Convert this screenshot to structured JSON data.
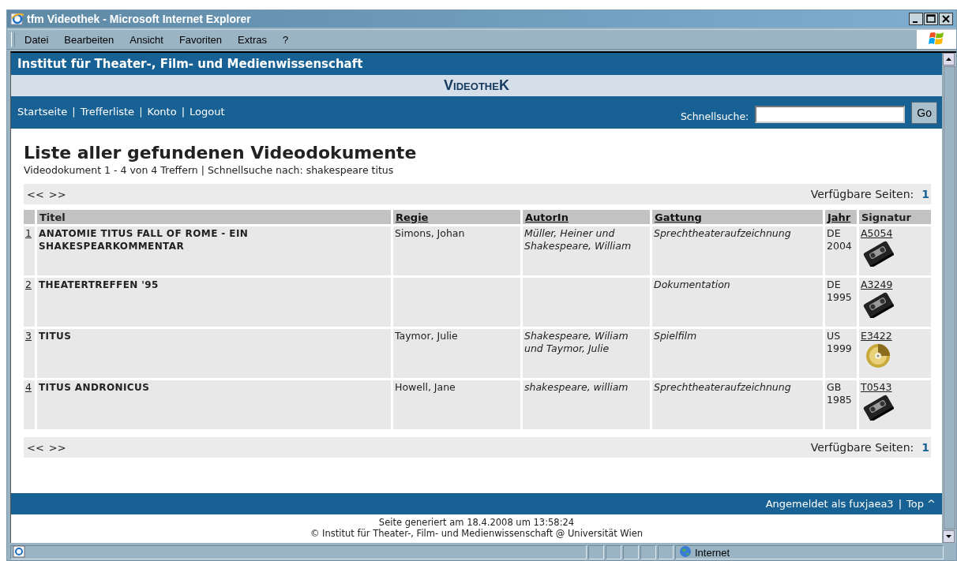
{
  "window": {
    "title": "tfm Videothek - Microsoft Internet Explorer"
  },
  "menu": [
    {
      "label": "Datei"
    },
    {
      "label": "Bearbeiten"
    },
    {
      "label": "Ansicht"
    },
    {
      "label": "Favoriten"
    },
    {
      "label": "Extras"
    },
    {
      "label": "?"
    }
  ],
  "header": {
    "institute": "Institut für Theater-, Film- und Medienwissenschaft",
    "banner": "VideotheK"
  },
  "nav": {
    "links": [
      "Startseite",
      "Trefferliste",
      "Konto",
      "Logout"
    ],
    "separators": [
      "|",
      "|",
      "|"
    ],
    "search_label": "Schnellsuche:",
    "go_button": "Go"
  },
  "heading": "Liste aller gefundenen Videodokumente",
  "summary": "Videodokument 1 - 4 von 4 Treffern | Schnellsuche nach: shakespeare titus",
  "pagers": [
    {
      "prev": "<<",
      "next": ">>",
      "pages_label": "Verfügbare Seiten:",
      "pages": [
        "1"
      ]
    },
    {
      "prev": "<<",
      "next": ">>",
      "pages_label": "Verfügbare Seiten:",
      "pages": [
        "1"
      ]
    }
  ],
  "table": {
    "columns": [
      {
        "label": "Titel",
        "sortable": false
      },
      {
        "label": "Regie",
        "sortable": true
      },
      {
        "label": "AutorIn",
        "sortable": true
      },
      {
        "label": "Gattung",
        "sortable": true
      },
      {
        "label": "Jahr",
        "sortable": true
      },
      {
        "label": "Signatur",
        "sortable": false
      }
    ],
    "rows": [
      {
        "number": "1",
        "title": "ANATOMIE TITUS FALL OF ROME - EIN SHAKESPEARKOMMENTAR",
        "director": "Simons, Johan",
        "author": "Müller, Heiner und Shakespeare, William",
        "genre": "Sprechtheateraufzeichnung",
        "country": "DE",
        "year": "2004",
        "signature": "A5054",
        "kind": "vhs"
      },
      {
        "number": "2",
        "title": "THEATERTREFFEN '95",
        "genre": "Dokumentation",
        "country": "DE",
        "year": "1995",
        "signature": "A3249",
        "kind": "vhs"
      },
      {
        "number": "3",
        "title": "TITUS",
        "director": "Taymor, Julie",
        "author": "Shakespeare, Wiliam und Taymor, Julie",
        "genre": "Spielfilm",
        "country": "US",
        "year": "1999",
        "signature": "E3422",
        "kind": "dvd"
      },
      {
        "number": "4",
        "title": "TITUS ANDRONICUS",
        "director": "Howell, Jane",
        "author": "shakespeare, william",
        "genre": "Sprechtheateraufzeichnung",
        "country": "GB",
        "year": "1985",
        "signature": "T0543",
        "kind": "vhs"
      }
    ]
  },
  "footer": {
    "logged_in": "Angemeldet als fuxjaea3",
    "separator": "|",
    "top_link": "Top ^",
    "generated": "Seite generiert am 18.4.2008 um 13:58:24",
    "copyright": "© Institut für Theater-, Film- und Medienwissenschaft @ Universität Wien"
  },
  "status_bar": {
    "zone": "Internet"
  }
}
